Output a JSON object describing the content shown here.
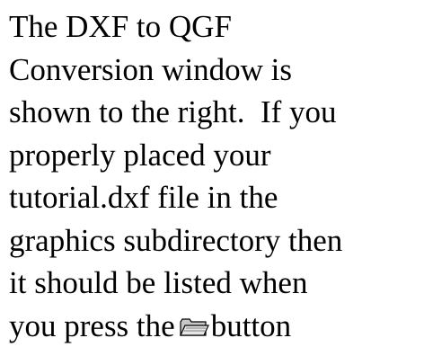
{
  "paragraph": {
    "lines": [
      "The DXF to QGF",
      "Conversion window is",
      "shown to the right.  If you",
      "properly placed your",
      "tutorial.dxf file in the",
      "graphics subdirectory then",
      "it should be listed when",
      "you press the"
    ],
    "after_icon": "button"
  },
  "icon": {
    "name": "open-folder-icon"
  }
}
